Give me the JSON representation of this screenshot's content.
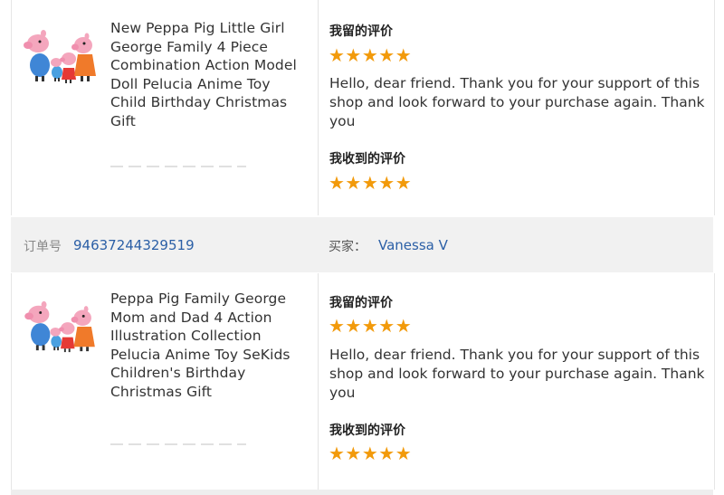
{
  "orders": [
    {
      "product_title": "New Peppa Pig Little Girl George Family 4 Piece Combination Action Model Doll Pelucia Anime Toy Child Birthday Christmas Gift",
      "my_review_heading": "我留的评价",
      "my_review_stars": "★★★★★",
      "my_review_rating": 5,
      "reply_text": "Hello, dear friend. Thank you for your support of this shop and look forward to your purchase again. Thank you",
      "received_review_heading": "我收到的评价",
      "received_review_stars": "★★★★★",
      "received_review_rating": 5
    },
    {
      "product_title": "Peppa Pig Family George Mom and Dad 4 Action Illustration Collection Pelucia Anime Toy SeKids Children's Birthday Christmas Gift",
      "my_review_heading": "我留的评价",
      "my_review_stars": "★★★★★",
      "my_review_rating": 5,
      "reply_text": "Hello, dear friend. Thank you for your support of this shop and look forward to your purchase again. Thank you",
      "received_review_heading": "我收到的评价",
      "received_review_stars": "★★★★★",
      "received_review_rating": 5
    }
  ],
  "order_bar": {
    "order_label": "订单号",
    "order_number": "94637244329519",
    "buyer_label": "买家：",
    "buyer_name": "Vanessa V"
  },
  "colors": {
    "star": "#f29a0b",
    "link": "#2b5fa6",
    "bar_background": "#f1f1f1"
  },
  "icons": {
    "product_thumbnail": "peppa-pig-family-figures-image",
    "rating_star": "star-icon"
  }
}
